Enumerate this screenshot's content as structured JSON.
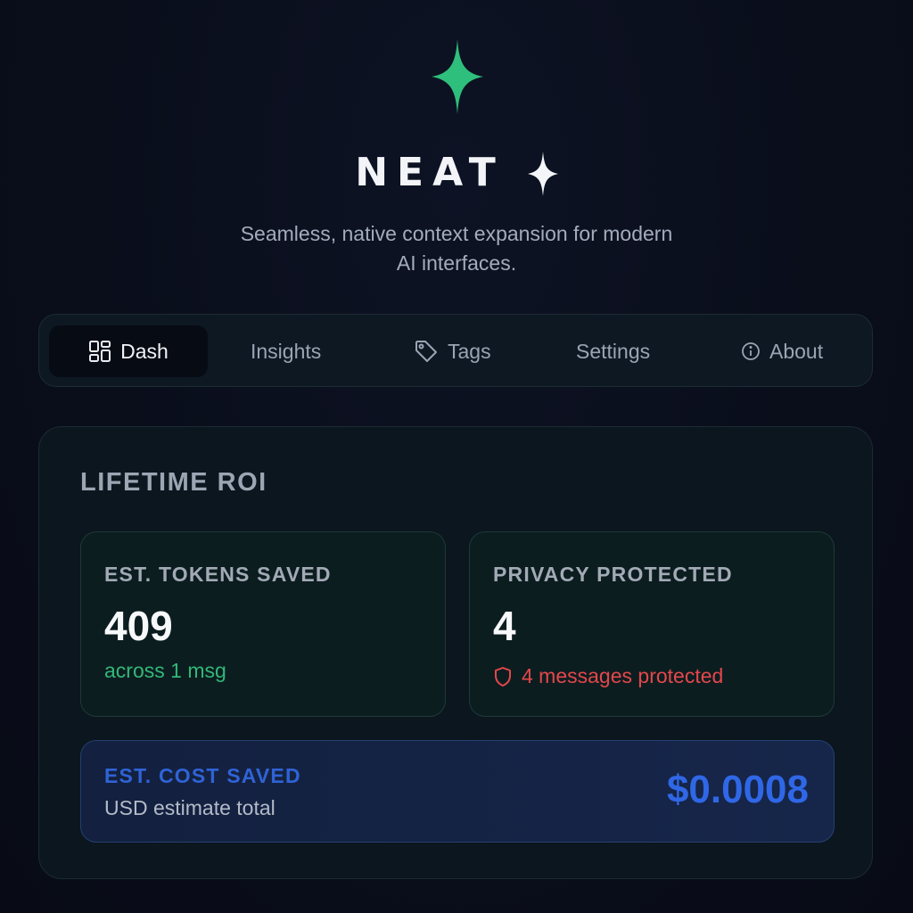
{
  "brand": {
    "name": "NEAT",
    "tagline_line1": "Seamless, native context expansion for modern",
    "tagline_line2": "AI interfaces.",
    "accent_color": "#2fbf7c",
    "logo_icon": "four-point-star-icon",
    "sparkle_icon": "sparkle-icon"
  },
  "nav": {
    "items": [
      {
        "label": "Dash",
        "icon": "dashboard-grid-icon",
        "active": true
      },
      {
        "label": "Insights",
        "icon": null,
        "active": false
      },
      {
        "label": "Tags",
        "icon": "tag-icon",
        "active": false
      },
      {
        "label": "Settings",
        "icon": null,
        "active": false
      },
      {
        "label": "About",
        "icon": "info-icon",
        "active": false
      }
    ]
  },
  "roi": {
    "title": "LIFETIME ROI",
    "tokens": {
      "label": "EST. TOKENS SAVED",
      "value": "409",
      "sub": "across 1 msg",
      "sub_color": "#32b877"
    },
    "privacy": {
      "label": "PRIVACY PROTECTED",
      "value": "4",
      "sub": "4 messages protected",
      "sub_icon": "shield-icon",
      "sub_color": "#e4474a"
    },
    "cost": {
      "label": "EST. COST SAVED",
      "sub": "USD estimate total",
      "value": "$0.0008",
      "color": "#2f67e6"
    }
  }
}
